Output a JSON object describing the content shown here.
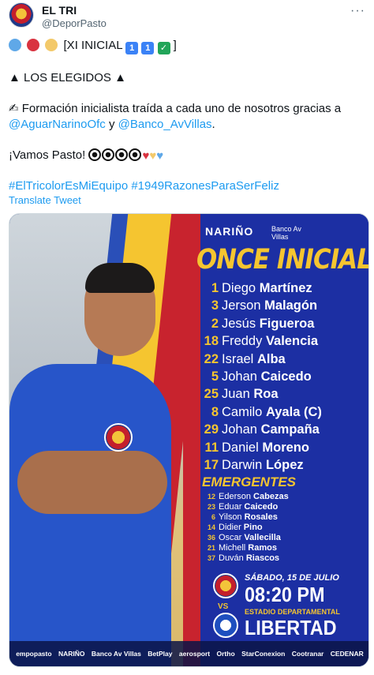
{
  "tweet": {
    "author_name": "EL TRI",
    "author_handle": "@DeporPasto",
    "more": "···",
    "line1_text": "[XI INICIAL ",
    "line1_num1": "1",
    "line1_num2": "1",
    "line1_check": "✓",
    "line1_end": "]",
    "line2": "LOS ELEGIDOS",
    "line3a": " Formación inicialista traída a cada uno de nosotros gracias a",
    "mention1": "@AguarNarinoOfc",
    "line3b": " y ",
    "mention2": "@Banco_AvVillas",
    "line3c": ".",
    "line4": "¡Vamos Pasto! ",
    "hashtags": "#ElTricolorEsMiEquipo #1949RazonesParaSerFeliz",
    "translate": "Translate Tweet",
    "dot_colors": [
      "#5fa8e8",
      "#d93340",
      "#f3c96a"
    ]
  },
  "poster": {
    "sponsor_main": "NARIÑO",
    "sponsor_bank": "Banco Av Villas",
    "title": "ONCE INICIAL",
    "players": [
      {
        "num": "1",
        "first": "Diego",
        "last": "Martínez"
      },
      {
        "num": "3",
        "first": "Jerson",
        "last": "Malagón"
      },
      {
        "num": "2",
        "first": "Jesús",
        "last": "Figueroa"
      },
      {
        "num": "18",
        "first": "Freddy",
        "last": "Valencia"
      },
      {
        "num": "22",
        "first": "Israel",
        "last": "Alba"
      },
      {
        "num": "5",
        "first": "Johan",
        "last": "Caicedo"
      },
      {
        "num": "25",
        "first": "Juan",
        "last": "Roa"
      },
      {
        "num": "8",
        "first": "Camilo",
        "last": "Ayala (C)"
      },
      {
        "num": "29",
        "first": "Johan",
        "last": "Campaña"
      },
      {
        "num": "11",
        "first": "Daniel",
        "last": "Moreno"
      },
      {
        "num": "17",
        "first": "Darwin",
        "last": "López"
      }
    ],
    "emergentes_title": "EMERGENTES",
    "subs": [
      {
        "num": "12",
        "first": "Ederson",
        "last": "Cabezas"
      },
      {
        "num": "23",
        "first": "Eduar",
        "last": "Caicedo"
      },
      {
        "num": "6",
        "first": "Yilson",
        "last": "Rosales"
      },
      {
        "num": "14",
        "first": "Didier",
        "last": "Pino"
      },
      {
        "num": "36",
        "first": "Oscar",
        "last": "Vallecilla"
      },
      {
        "num": "21",
        "first": "Michell",
        "last": "Ramos"
      },
      {
        "num": "37",
        "first": "Duván",
        "last": "Riascos"
      }
    ],
    "match_date": "SÁBADO, 15 DE JULIO",
    "match_time": "08:20 PM",
    "vs": "VS",
    "stadium_label": "ESTADIO DEPARTAMENTAL",
    "stadium_name": "LIBERTAD",
    "footer_sponsors": [
      "empopasto",
      "NARIÑO",
      "Banco Av Villas",
      "BetPlay",
      "aerosport",
      "Ortho",
      "StarConexion",
      "Cootranar",
      "CEDENAR"
    ]
  }
}
